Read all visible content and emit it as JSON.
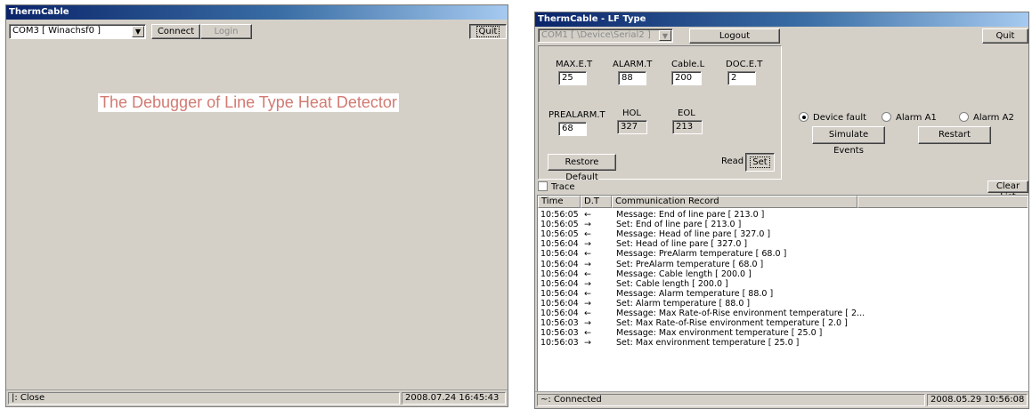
{
  "left": {
    "title": "ThermCable",
    "port": "COM3 [ Winachsf0 ]",
    "connect": "Connect",
    "login": "Login",
    "quit": "Quit",
    "banner": "The Debugger of Line Type Heat Detector",
    "status_left": "|: Close",
    "status_right": "2008.07.24 16:45:43"
  },
  "right": {
    "title": "ThermCable - LF Type",
    "port": "COM1 [ \\Device\\Serial2 ]",
    "logout": "Logout",
    "quit": "Quit",
    "params": {
      "max_et_label": "MAX.E.T",
      "max_et": "25",
      "alarm_t_label": "ALARM.T",
      "alarm_t": "88",
      "cable_l_label": "Cable.L",
      "cable_l": "200",
      "doc_et_label": "DOC.E.T",
      "doc_et": "2",
      "prealarm_t_label": "PREALARM.T",
      "prealarm_t": "68",
      "hol_label": "HOL",
      "hol": "327",
      "eol_label": "EOL",
      "eol": "213"
    },
    "restore": "Restore Default",
    "read": "Read",
    "set": "Set",
    "radios": {
      "device_fault": "Device fault",
      "alarm_a1": "Alarm A1",
      "alarm_a2": "Alarm A2",
      "selected": "device_fault"
    },
    "simulate": "Simulate Events",
    "restart": "Restart",
    "trace": "Trace",
    "clear_list": "Clear List",
    "columns": [
      "Time",
      "D.T",
      "Communication Record"
    ],
    "rows": [
      {
        "time": "10:56:05",
        "dir": "←",
        "msg": "Message: End of line pare [ 213.0 ]"
      },
      {
        "time": "10:56:05",
        "dir": "→",
        "msg": "Set: End of line pare [ 213.0 ]"
      },
      {
        "time": "10:56:05",
        "dir": "←",
        "msg": "Message: Head of line pare [ 327.0 ]"
      },
      {
        "time": "10:56:04",
        "dir": "→",
        "msg": "Set: Head of line pare [ 327.0 ]"
      },
      {
        "time": "10:56:04",
        "dir": "←",
        "msg": "Message: PreAlarm temperature [ 68.0 ]"
      },
      {
        "time": "10:56:04",
        "dir": "→",
        "msg": "Set: PreAlarm temperature [ 68.0 ]"
      },
      {
        "time": "10:56:04",
        "dir": "←",
        "msg": "Message: Cable length [ 200.0 ]"
      },
      {
        "time": "10:56:04",
        "dir": "→",
        "msg": "Set: Cable length [ 200.0 ]"
      },
      {
        "time": "10:56:04",
        "dir": "←",
        "msg": "Message: Alarm temperature [ 88.0 ]"
      },
      {
        "time": "10:56:04",
        "dir": "→",
        "msg": "Set: Alarm temperature [ 88.0 ]"
      },
      {
        "time": "10:56:04",
        "dir": "←",
        "msg": "Message: Max Rate-of-Rise environment temperature [ 2..."
      },
      {
        "time": "10:56:03",
        "dir": "→",
        "msg": "Set: Max Rate-of-Rise environment temperature [ 2.0 ]"
      },
      {
        "time": "10:56:03",
        "dir": "←",
        "msg": "Message: Max environment temperature [ 25.0 ]"
      },
      {
        "time": "10:56:03",
        "dir": "→",
        "msg": "Set: Max environment temperature [ 25.0 ]"
      }
    ],
    "status_left": "~: Connected",
    "status_right": "2008.05.29 10:56:08"
  },
  "colors": {
    "banner": "#d27a72",
    "titlebar": "#0a246a",
    "face": "#d4d0c8"
  }
}
